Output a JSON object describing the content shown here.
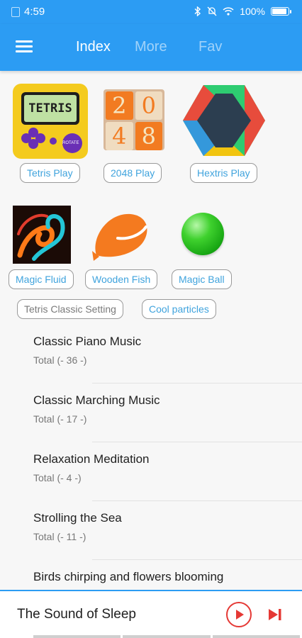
{
  "status": {
    "time": "4:59",
    "battery": "100%"
  },
  "tabs": [
    {
      "label": "Index",
      "active": true
    },
    {
      "label": "More",
      "active": false
    },
    {
      "label": "Fav",
      "active": false
    }
  ],
  "games_row1": [
    {
      "label": "Tetris Play",
      "icon_text": "TETRIS",
      "icon_sub": "ROTATE"
    },
    {
      "label": "2048 Play",
      "digits": [
        "2",
        "0",
        "4",
        "8"
      ]
    },
    {
      "label": "Hextris Play"
    }
  ],
  "games_row2": [
    {
      "label": "Magic Fluid"
    },
    {
      "label": "Wooden Fish"
    },
    {
      "label": "Magic Ball"
    }
  ],
  "games_row3": [
    {
      "label": "Tetris Classic Setting"
    },
    {
      "label": "Cool particles"
    }
  ],
  "playlists": [
    {
      "title": "Classic Piano Music",
      "total": "Total (- 36 -)"
    },
    {
      "title": "Classic Marching Music",
      "total": "Total (- 17 -)"
    },
    {
      "title": "Relaxation Meditation",
      "total": "Total (- 4 -)"
    },
    {
      "title": "Strolling the Sea",
      "total": "Total (- 11 -)"
    },
    {
      "title": "Birds chirping and flowers blooming",
      "total": ""
    }
  ],
  "player": {
    "title": "The Sound of Sleep"
  },
  "colors": {
    "primary": "#2c9cf3",
    "accent": "#e53935",
    "link": "#3fa3dd"
  }
}
